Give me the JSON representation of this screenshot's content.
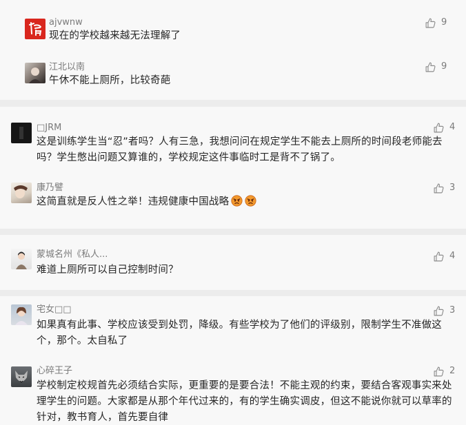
{
  "cards": [
    {
      "comments": [
        {
          "nickname": "ajvwnw",
          "text": "现在的学校越来越无法理解了",
          "likes": "9",
          "avatar_icon": "calligraphy-fu-avatar"
        },
        {
          "nickname": "江北以南",
          "text": "午休不能上厕所，比较奇葩",
          "likes": "9",
          "avatar_icon": "photo-avatar"
        }
      ]
    },
    {
      "comments": [
        {
          "nickname": "□JRM",
          "text": "这是训练学生当“忍”者吗？人有三急，我想问问在规定学生不能去上厕所的时间段老师能去吗？学生憋出问题又算谁的，学校规定这件事临时工是背不了锅了。",
          "likes": "4",
          "avatar_icon": "dark-photo-avatar"
        },
        {
          "nickname": "康乃譬",
          "text": "这简直就是反人性之举！违规健康中国战略",
          "likes": "3",
          "avatar_icon": "photo-avatar",
          "emojis": [
            "angry-face-emoji",
            "angry-face-emoji"
          ]
        }
      ]
    },
    {
      "comments": [
        {
          "nickname": "蒙城名州《私人...",
          "text": "难道上厕所可以自己控制时间？",
          "likes": "4",
          "avatar_icon": "photo-avatar"
        }
      ]
    },
    {
      "comments": [
        {
          "nickname": "宅女□□",
          "text": "如果真有此事、学校应该受到处罚，降级。有些学校为了他们的评级别，限制学生不准做这个，那个。太自私了",
          "likes": "3",
          "avatar_icon": "photo-avatar"
        },
        {
          "nickname": "心碎王子",
          "text": "学校制定校规首先必须结合实际，更重要的是要合法！不能主观的约束，要结合客观事实来处理学生的问题。大家都是从那个年代过来的，有的学生确实调皮，但这不能说你就可以草率的针对，教书育人，首先要自律",
          "likes": "2",
          "avatar_icon": "wolf-photo-avatar"
        }
      ]
    }
  ],
  "colors": {
    "page_bg": "#ececec",
    "card_bg": "#f8f8f8",
    "nickname": "#7a7a7a",
    "text": "#262626",
    "like_icon": "#8c8c8c"
  }
}
